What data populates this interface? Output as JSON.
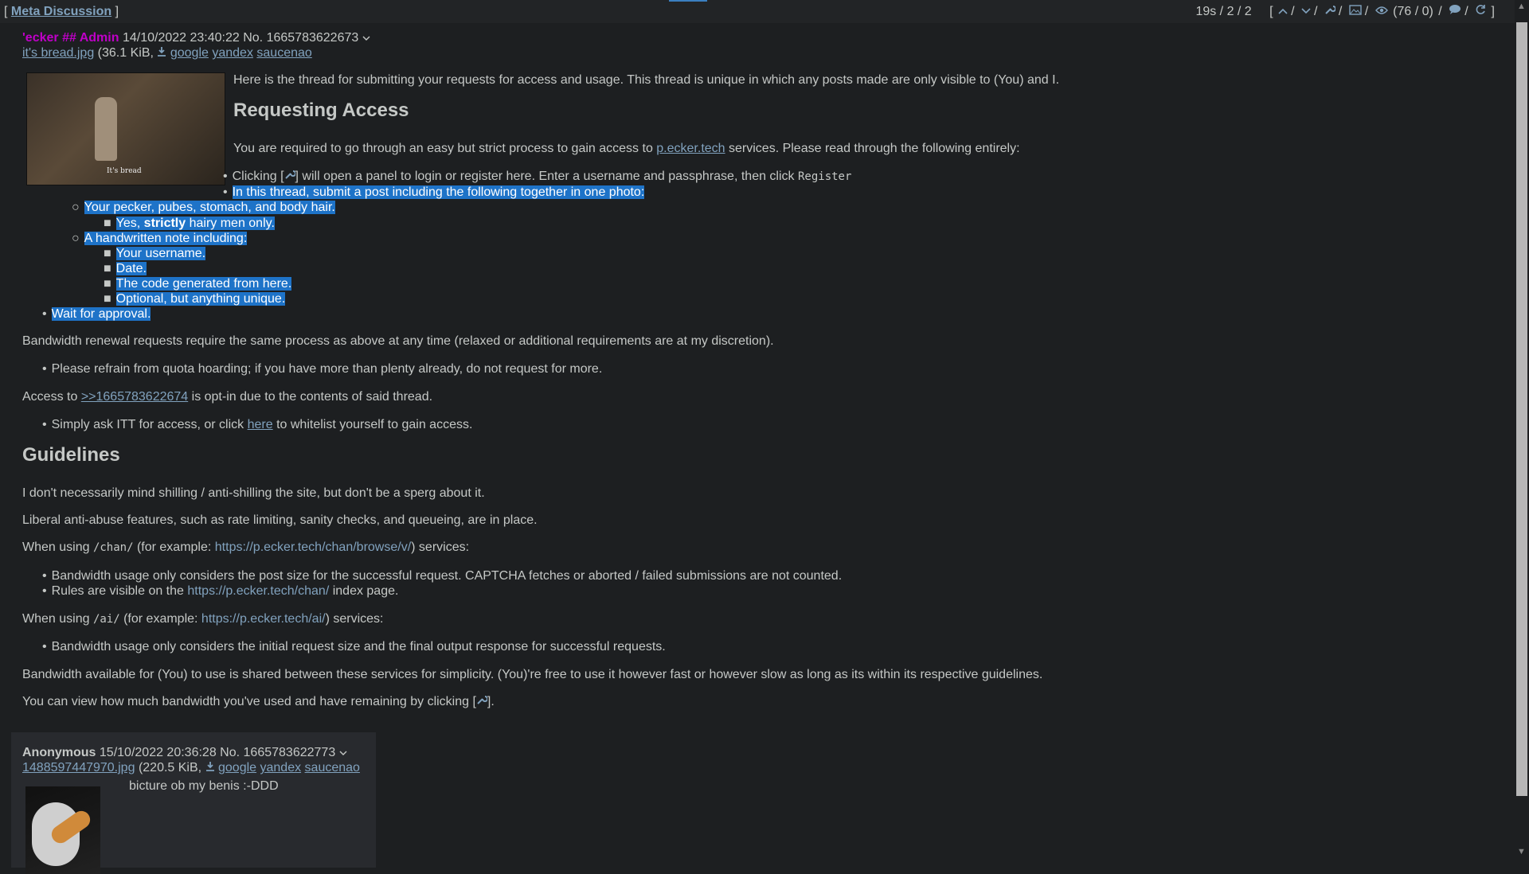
{
  "topbar": {
    "board_link": "Meta Discussion",
    "stats": "19s / 2 / 2",
    "counts": "(76 / 0)",
    "icons": [
      "up-arrow-icon",
      "down-arrow-icon",
      "wrench-icon",
      "image-icon",
      "eye-icon",
      "chat-bubble-icon",
      "refresh-icon"
    ]
  },
  "op": {
    "name": "'ecker ## Admin",
    "datetime": "14/10/2022 23:40:22",
    "no_label": "No.",
    "post_no": "1665783622673",
    "file_name": "it's bread.jpg",
    "file_size": "(36.1 KiB,",
    "search_links": [
      "google",
      "yandex",
      "saucenao"
    ],
    "thumb_caption": "It's bread",
    "intro": "Here is the thread for submitting your requests for access and usage. This thread is unique in which any posts made are only visible to (You) and I.",
    "h_access": "Requesting Access",
    "access_p1_a": "You are required to go through an easy but strict process to gain access to ",
    "access_link": "p.ecker.tech",
    "access_p1_b": " services. Please read through the following entirely:",
    "clicking_a": "Clicking [",
    "clicking_b": "] will open a panel to login or register here. Enter a username and passphrase, then click ",
    "register_code": "Register",
    "submit_line": "In this thread, submit a post including the following together in one photo:",
    "sub1": "Your pecker, pubes, stomach, and body hair.",
    "sub1_1_a": "Yes, ",
    "sub1_1_b": "strictly",
    "sub1_1_c": " hairy men only.",
    "sub2": "A handwritten note including:",
    "sub2_items": [
      "Your username.",
      "Date.",
      "The code generated from here.",
      "Optional, but anything unique."
    ],
    "wait": "Wait for approval.",
    "bandwidth_renewal": "Bandwidth renewal requests require the same process as above at any time (relaxed or additional requirements are at my discretion).",
    "hoarding": "Please refrain from quota hoarding; if you have more than plenty already, do not request for more.",
    "access_to_a": "Access to ",
    "access_to_link": ">>1665783622674",
    "access_to_b": " is opt-in due to the contents of said thread.",
    "itt_a": "Simply ask ITT for access, or click ",
    "itt_link": "here",
    "itt_b": " to whitelist yourself to gain access.",
    "h_guidelines": "Guidelines",
    "g1": "I don't necessarily mind shilling / anti-shilling the site, but don't be a sperg about it.",
    "g2": "Liberal anti-abuse features, such as rate limiting, sanity checks, and queueing, are in place.",
    "chan_a": "When using ",
    "chan_code": "/chan/",
    "chan_b": " (for example: ",
    "chan_link": "https://p.ecker.tech/chan/browse/v/",
    "chan_c": ") services:",
    "chan_b1": "Bandwidth usage only considers the post size for the successful request. CAPTCHA fetches or aborted / failed submissions are not counted.",
    "chan_b2_a": "Rules are visible on the ",
    "chan_b2_link": "https://p.ecker.tech/chan/",
    "chan_b2_b": " index page.",
    "ai_a": "When using ",
    "ai_code": "/ai/",
    "ai_b": " (for example: ",
    "ai_link": "https://p.ecker.tech/ai/",
    "ai_c": ") services:",
    "ai_b1": "Bandwidth usage only considers the initial request size and the final output response for successful requests.",
    "shared": "Bandwidth available for (You) to use is shared between these services for simplicity. (You)'re free to use it however fast or however slow as long as its within its respective guidelines.",
    "view_a": "You can view how much bandwidth you've used and have remaining by clicking [",
    "view_b": "]."
  },
  "reply": {
    "name": "Anonymous",
    "datetime": "15/10/2022 20:36:28",
    "no_label": "No.",
    "post_no": "1665783622773",
    "file_name": "1488597447970.jpg",
    "file_size": "(220.5 KiB,",
    "search_links": [
      "google",
      "yandex",
      "saucenao"
    ],
    "comment": "bicture ob my benis :-DDD"
  },
  "colors": {
    "background": "#1d1f21",
    "text": "#c5c8c6",
    "link": "#81a2be",
    "admin_name": "#c000c8",
    "selection": "#1e73c8",
    "reply_bg": "#282a2e"
  }
}
